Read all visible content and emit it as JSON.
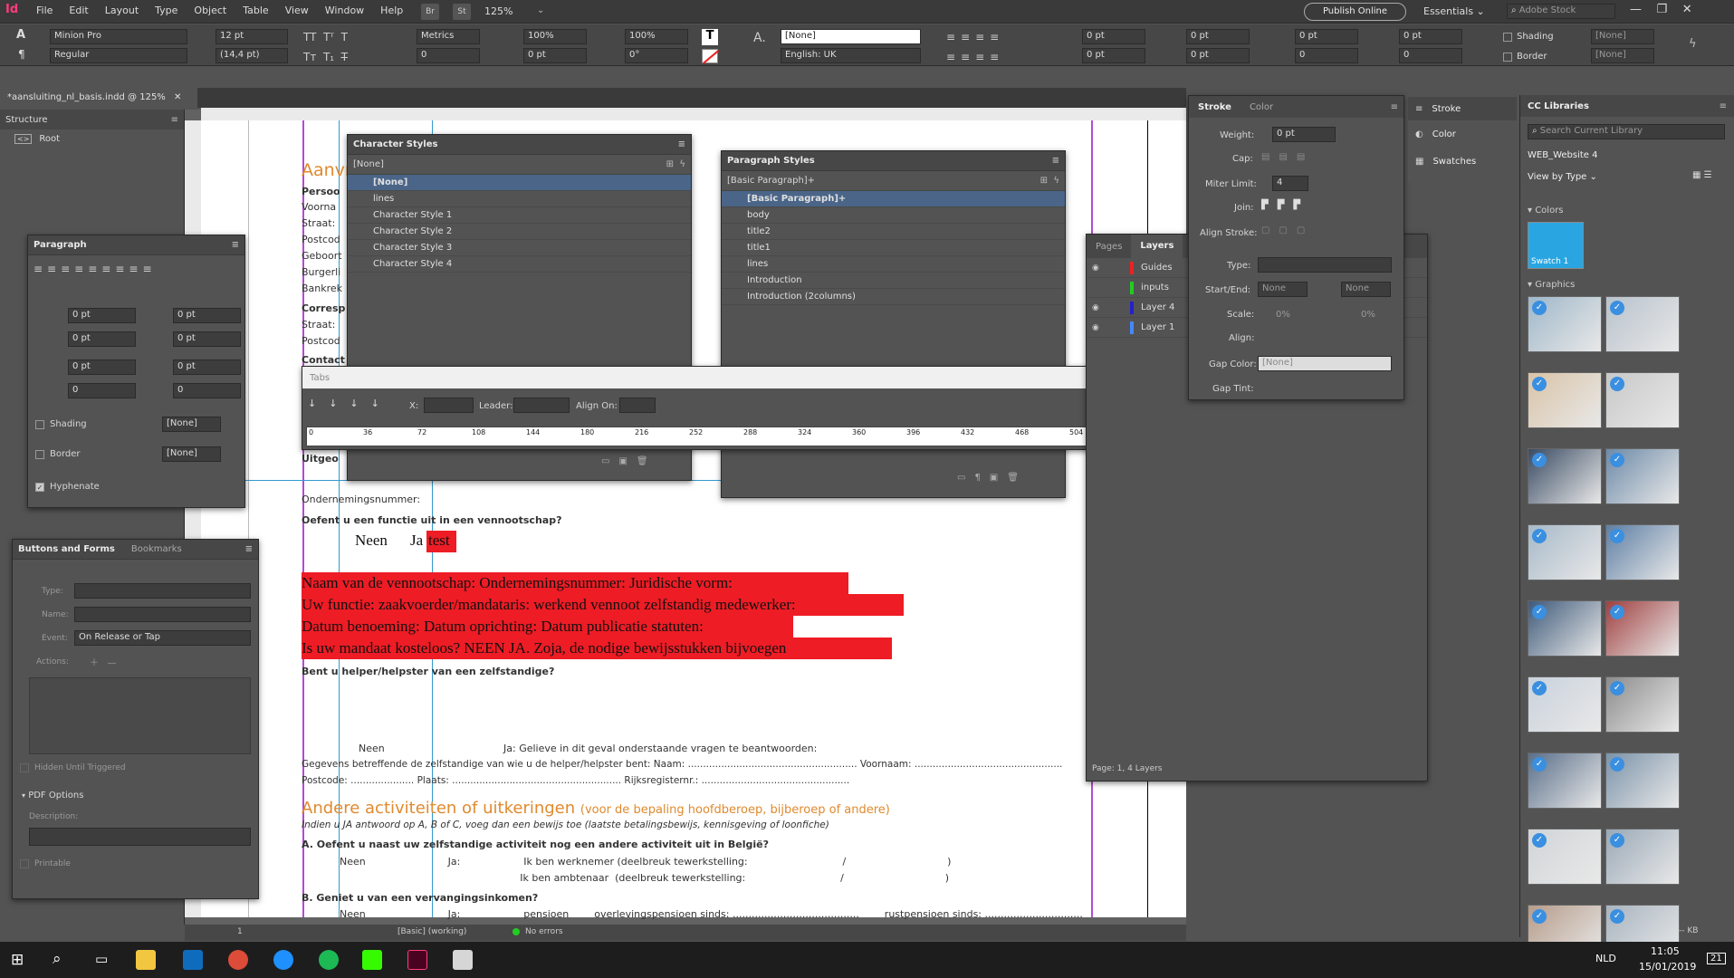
{
  "menubar": {
    "app_icon": "Id",
    "items": [
      "File",
      "Edit",
      "Layout",
      "Type",
      "Object",
      "Table",
      "View",
      "Window",
      "Help"
    ],
    "zoom": "125%",
    "publish": "Publish Online",
    "workspace": "Essentials",
    "search_placeholder": "Adobe Stock"
  },
  "control": {
    "font": "Minion Pro",
    "style": "Regular",
    "size": "12 pt",
    "leading": "(14,4 pt)",
    "kerning": "Metrics",
    "tracking": "0",
    "vscale": "100%",
    "hscale": "100%",
    "baseline": "0 pt",
    "skew": "0°",
    "char_style": "[None]",
    "language": "English: UK",
    "indent1": "0 pt",
    "indent2": "0 pt",
    "indent3": "0 pt",
    "indent4": "0 pt",
    "indent5": "0 pt",
    "indent6": "0 pt",
    "indent7": "0",
    "indent8": "0",
    "shading": "Shading",
    "border": "Border",
    "none1": "[None]",
    "none2": "[None]"
  },
  "doc_tab": "*aansluiting_nl_basis.indd @ 125%",
  "structure": {
    "title": "Structure",
    "root": "Root"
  },
  "paragraph_panel": {
    "title": "Paragraph",
    "v1": "0 pt",
    "v2": "0 pt",
    "v3": "0 pt",
    "v4": "0 pt",
    "v5": "0 pt",
    "v6": "0 pt",
    "v7": "0",
    "v8": "0",
    "shading": "Shading",
    "border": "Border",
    "none": "[None]",
    "hyphenate": "Hyphenate"
  },
  "buttons_panel": {
    "tab1": "Buttons and Forms",
    "tab2": "Bookmarks",
    "type": "Type:",
    "name": "Name:",
    "event": "Event:",
    "event_value": "On Release or Tap",
    "actions": "Actions:",
    "hidden": "Hidden Until Triggered",
    "pdf": "PDF Options",
    "description": "Description:",
    "printable": "Printable"
  },
  "char_styles": {
    "title": "Character Styles",
    "current": "[None]",
    "items": [
      "[None]",
      "lines",
      "Character Style 1",
      "Character Style 2",
      "Character Style 3",
      "Character Style 4"
    ]
  },
  "para_styles": {
    "title": "Paragraph Styles",
    "current": "[Basic Paragraph]+",
    "items": [
      "[Basic Paragraph]+",
      "body",
      "title2",
      "title1",
      "lines",
      "Introduction",
      "Introduction (2columns)"
    ]
  },
  "tabs_panel": {
    "title": "Tabs",
    "x": "X:",
    "leader": "Leader:",
    "align_on": "Align On:",
    "ruler": [
      "0",
      "36",
      "72",
      "108",
      "144",
      "180",
      "216",
      "252",
      "288",
      "324",
      "360",
      "396",
      "432",
      "468",
      "504"
    ]
  },
  "layers": {
    "tab1": "Pages",
    "tab2": "Layers",
    "items": [
      {
        "name": "Guides",
        "color": "#e22"
      },
      {
        "name": "inputs",
        "color": "#2c2"
      },
      {
        "name": "Layer 4",
        "color": "#22c"
      },
      {
        "name": "Layer 1",
        "color": "#48f"
      }
    ],
    "footer": "Page: 1, 4 Layers"
  },
  "stroke_panel": {
    "tab1": "Stroke",
    "tab2": "Color",
    "weight": "Weight:",
    "weight_val": "0 pt",
    "cap": "Cap:",
    "miter": "Miter Limit:",
    "miter_val": "4",
    "join": "Join:",
    "align": "Align Stroke:",
    "type": "Type:",
    "startend": "Start/End:",
    "start": "None",
    "end": "None",
    "scale": "Scale:",
    "scale1": "0%",
    "scale2": "0%",
    "align2": "Align:",
    "gapcolor": "Gap Color:",
    "gapcolor_val": "[None]",
    "gaptint": "Gap Tint:"
  },
  "dock": {
    "items": [
      "Stroke",
      "Color",
      "Swatches"
    ]
  },
  "cc_libraries": {
    "title": "CC Libraries",
    "search": "Search Current Library",
    "library": "WEB_Website 4",
    "view": "View by Type",
    "colors": "Colors",
    "swatch": "Swatch 1",
    "graphics": "Graphics",
    "size": "-- KB"
  },
  "document": {
    "heading1": "Aanvr",
    "left_labels": [
      "Persoo",
      "Voorna",
      "Straat:",
      "Postcod",
      "Geboort",
      "Burgerli",
      "Bankrek",
      "Corresp",
      "Straat:",
      "Postcod",
      "Contact",
      "Uitgeo"
    ],
    "ondernemings": "Ondernemingsnummer:",
    "q_functie": "Oefent u een functie uit in een vennootschap?",
    "neen": "Neen",
    "ja": "Ja",
    "test": "test",
    "red_lines": [
      "Naam van de vennootschap: Ondernemingsnummer: Juridische vorm:",
      "Uw functie:  zaakvoerder/mandataris: werkend vennoot zelfstandig medewerker:",
      "Datum benoeming: Datum oprichting: Datum publicatie statuten:",
      "Is uw mandaat kosteloos?       NEEN  JA. Zoja, de nodige bewijsstukken bijvoegen"
    ],
    "q_helper": "Bent u helper/helpster van een zelfstandige?",
    "neen2": "Neen",
    "ja2": "Ja: Gelieve in dit geval onderstaande vragen te beantwoorden:",
    "gegevens": "Gegevens betreffende de zelfstandige van wie u de helper/helpster bent: Naam: ........................................................ Voornaam: .................................................",
    "postcode": "Postcode: ..................... Plaats: ........................................................ Rijksregisternr.: .................................................",
    "heading2": "Andere activiteiten of uitkeringen",
    "heading2_sub": "(voor de bepaling hoofdberoep, bijberoep of andere)",
    "italic_note": "Indien u JA antwoord op A, B of C, voeg dan een bewijs toe (laatste betalingsbewijs, kennisgeving of loonfiche)",
    "qa": "A. Oefent u naast uw zelfstandige activiteit nog een andere activiteit uit in België?",
    "qa1": "Neen                          Ja:                    Ik ben werknemer (deelbreuk tewerkstelling:                              /                                )",
    "qa2": "                                                         Ik ben ambtenaar  (deelbreuk tewerkstelling:                              /                                )",
    "qb": "B. Geniet u van een vervangingsinkomen?",
    "qb1": "Neen                          Ja:                    pensioen        overlevingspensioen sinds: ........................................        rustpensioen sinds: ..............................."
  },
  "status": {
    "page": "1",
    "style": "[Basic] (working)",
    "errors": "No errors"
  },
  "taskbar": {
    "lang": "NLD",
    "time": "11:05",
    "date": "15/01/2019",
    "notif": "21"
  }
}
